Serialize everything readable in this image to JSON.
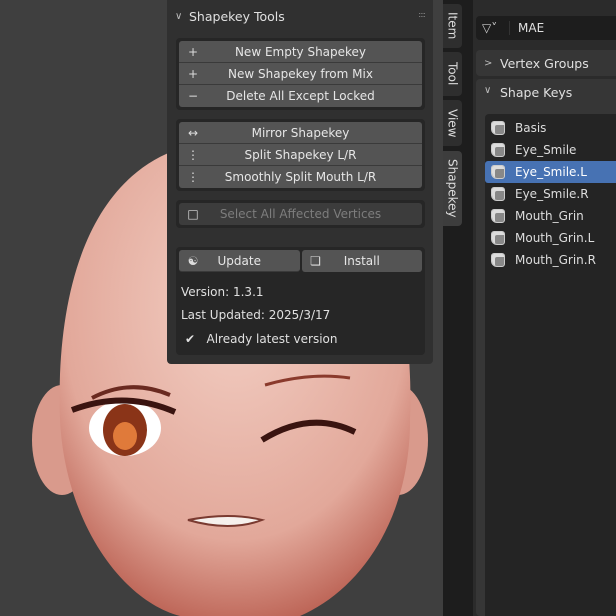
{
  "npanel": {
    "title": "Shapekey Tools",
    "group1": [
      {
        "icon": "plus-icon",
        "label": "New Empty Shapekey"
      },
      {
        "icon": "plus-icon",
        "label": "New Shapekey from Mix"
      },
      {
        "icon": "minus-icon",
        "label": "Delete All Except Locked"
      }
    ],
    "group2": [
      {
        "icon": "mirror-arrows-icon",
        "label": "Mirror Shapekey"
      },
      {
        "icon": "split-icon",
        "label": "Split Shapekey L/R"
      },
      {
        "icon": "split-icon",
        "label": "Smoothly Split Mouth L/R"
      }
    ],
    "select_label": "Select All Affected Vertices",
    "update_label": "Update",
    "install_label": "Install",
    "version": "Version: 1.3.1",
    "last_updated": "Last Updated: 2025/3/17",
    "status": "Already latest version"
  },
  "tabs": [
    "Item",
    "Tool",
    "View",
    "Shapekey"
  ],
  "properties": {
    "object_name": "MAE",
    "vertex_groups": "Vertex Groups",
    "shape_keys": "Shape Keys",
    "keys": [
      "Basis",
      "Eye_Smile",
      "Eye_Smile.L",
      "Eye_Smile.R",
      "Mouth_Grin",
      "Mouth_Grin.L",
      "Mouth_Grin.R"
    ],
    "selected_index": 2
  },
  "colors": {
    "selection": "#4772b3",
    "skin": "#e9b7aa"
  }
}
